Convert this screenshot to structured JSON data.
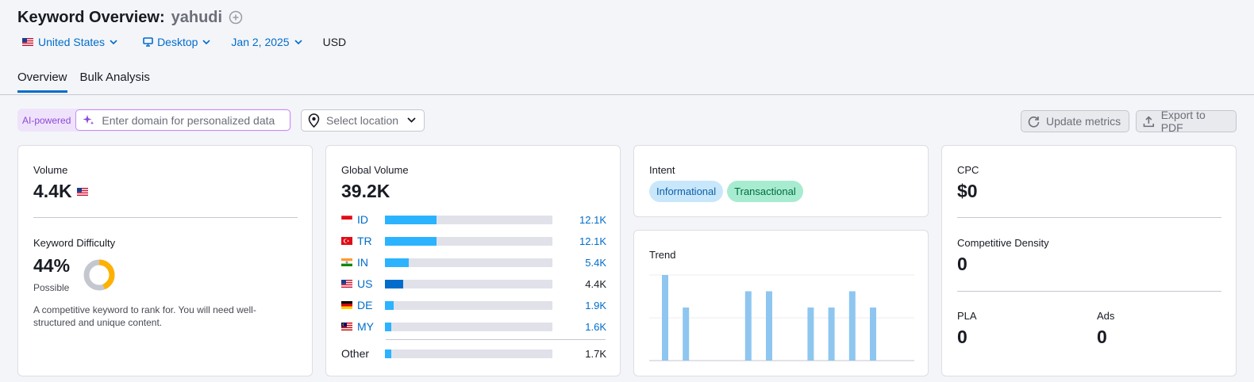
{
  "header": {
    "title": "Keyword Overview:",
    "keyword": "yahudi"
  },
  "filters": {
    "country": "United States",
    "device": "Desktop",
    "date": "Jan 2, 2025",
    "currency": "USD"
  },
  "tabs": [
    {
      "label": "Overview",
      "active": true
    },
    {
      "label": "Bulk Analysis",
      "active": false
    }
  ],
  "toolbar": {
    "ai_label": "AI-powered",
    "domain_placeholder": "Enter domain for personalized data",
    "location_placeholder": "Select location",
    "update_label": "Update metrics",
    "export_label": "Export to PDF"
  },
  "volume": {
    "label": "Volume",
    "value": "4.4K",
    "kd_label": "Keyword Difficulty",
    "kd_value": "44%",
    "kd_fraction": 0.44,
    "kd_level": "Possible",
    "kd_description": "A competitive keyword to rank for. You will need well-structured and unique content."
  },
  "global_volume": {
    "label": "Global Volume",
    "value": "39.2K",
    "rows": [
      {
        "code": "ID",
        "value": "12.1K",
        "share": 0.31
      },
      {
        "code": "TR",
        "value": "12.1K",
        "share": 0.31
      },
      {
        "code": "IN",
        "value": "5.4K",
        "share": 0.14
      },
      {
        "code": "US",
        "value": "4.4K",
        "share": 0.11
      },
      {
        "code": "DE",
        "value": "1.9K",
        "share": 0.05
      },
      {
        "code": "MY",
        "value": "1.6K",
        "share": 0.04
      }
    ],
    "other": {
      "label": "Other",
      "value": "1.7K",
      "share": 0.04
    }
  },
  "intent": {
    "label": "Intent",
    "pills": [
      "Informational",
      "Transactional"
    ]
  },
  "trend": {
    "label": "Trend"
  },
  "chart_data": {
    "type": "bar",
    "values": [
      1.0,
      0.62,
      0,
      0,
      0.81,
      0.81,
      0,
      0.62,
      0.62,
      0.81,
      0.62,
      0
    ],
    "ylim": [
      0,
      1
    ]
  },
  "cpc": {
    "label": "CPC",
    "value": "$0",
    "density_label": "Competitive Density",
    "density_value": "0",
    "pla_label": "PLA",
    "pla_value": "0",
    "ads_label": "Ads",
    "ads_value": "0"
  },
  "colors": {
    "accent": "#006dca",
    "bar": "#2bb3ff",
    "kd_donut": "#ffb100",
    "trend_bar": "#8ec6f0"
  }
}
